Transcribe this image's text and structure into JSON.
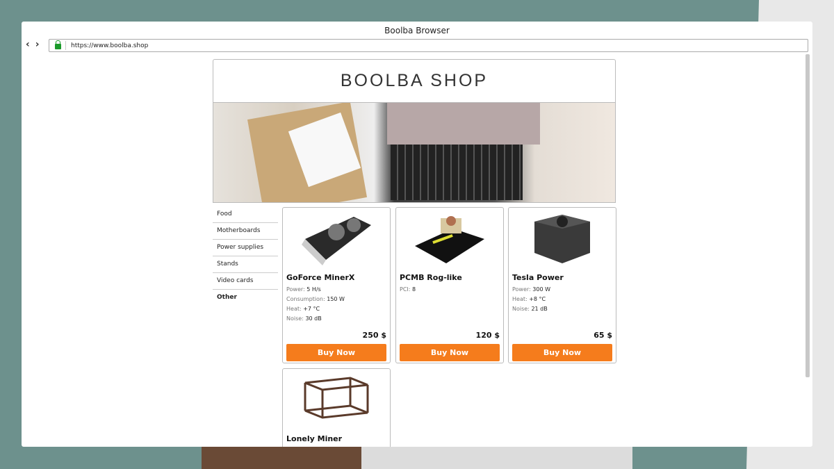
{
  "browser": {
    "title": "Boolba Browser",
    "url": "https://www.boolba.shop"
  },
  "shop": {
    "title": "BOOLBA SHOP"
  },
  "categories": [
    "Food",
    "Motherboards",
    "Power supplies",
    "Stands",
    "Video cards",
    "Other"
  ],
  "products": [
    {
      "name": "GoForce MinerX",
      "specs": [
        {
          "k": "Power: ",
          "v": "5 H/s"
        },
        {
          "k": "Consumption: ",
          "v": "150 W"
        },
        {
          "k": "Heat: ",
          "v": "+7 °C"
        },
        {
          "k": "Noise: ",
          "v": "30 dB"
        }
      ],
      "price": "250 $",
      "buy": "Buy Now"
    },
    {
      "name": "PCMB Rog-like",
      "specs": [
        {
          "k": "PCI: ",
          "v": "8"
        }
      ],
      "price": "120 $",
      "buy": "Buy Now"
    },
    {
      "name": "Tesla Power",
      "specs": [
        {
          "k": "Power: ",
          "v": "300 W"
        },
        {
          "k": "Heat: ",
          "v": "+8 °C"
        },
        {
          "k": "Noise: ",
          "v": "21 dB"
        }
      ],
      "price": "65 $",
      "buy": "Buy Now"
    },
    {
      "name": "Lonely Miner"
    }
  ],
  "colors": {
    "buy_button": "#f57c1c",
    "lock": "#1a9a2a"
  }
}
